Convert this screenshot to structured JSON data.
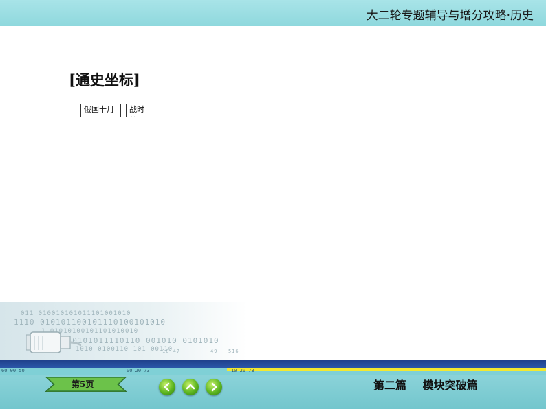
{
  "header": {
    "title": "大二轮专题辅导与增分攻略·历史"
  },
  "main": {
    "section_title": "[通史坐标]",
    "timeline_boxes": [
      {
        "label": "俄国十月"
      },
      {
        "label": "战时共"
      }
    ]
  },
  "decoration": {
    "digit_rows": [
      "011 010010101011101001010",
      "1110 010101100101110100101010",
      "1 01010100101101010010",
      "010101011110110 001010 0101010",
      "1010 0100110 101 00110"
    ],
    "ruler_left": "60 00 50",
    "ruler_mid": "00 20 73",
    "ruler_right": "10 20 73",
    "scale_labels": [
      "10 47",
      "49",
      "516"
    ]
  },
  "footer": {
    "page_label": "第5页",
    "section_label": "第二篇 模块突破篇",
    "nav_icons": [
      "chevron-left-icon",
      "chevron-up-icon",
      "chevron-right-icon"
    ]
  },
  "colors": {
    "header_bg": "#a8e4e8",
    "footer_bg": "#8bd3d9",
    "band_blue": "#1f3f8a",
    "accent_yellow": "#f3e830",
    "nav_green": "#5cb51f"
  }
}
